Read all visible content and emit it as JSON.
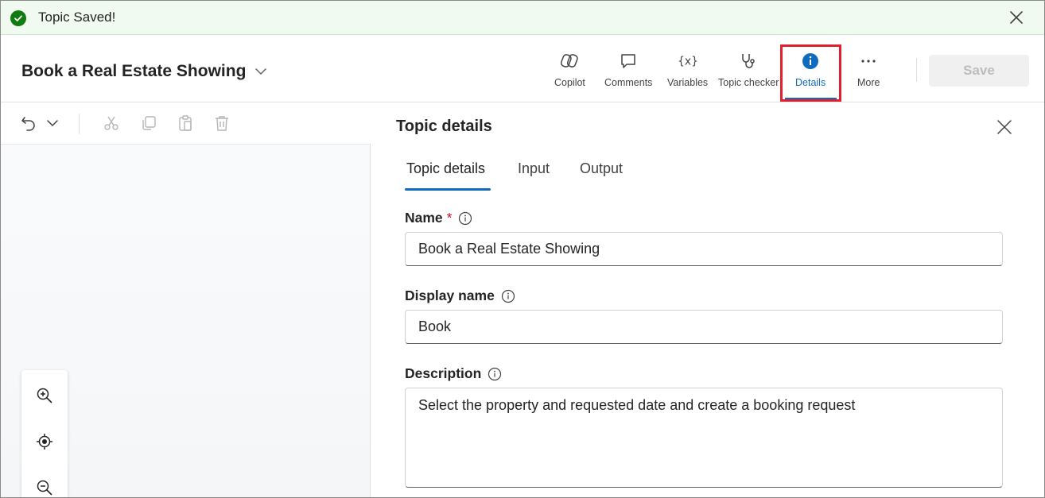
{
  "banner": {
    "message": "Topic Saved!",
    "status_color": "#107c10"
  },
  "header": {
    "title": "Book a Real Estate Showing",
    "tools": [
      {
        "id": "copilot",
        "label": "Copilot",
        "icon": "copilot-icon"
      },
      {
        "id": "comments",
        "label": "Comments",
        "icon": "comment-icon"
      },
      {
        "id": "variables",
        "label": "Variables",
        "icon": "variables-icon"
      },
      {
        "id": "topic_checker",
        "label": "Topic checker",
        "icon": "stethoscope-icon"
      },
      {
        "id": "details",
        "label": "Details",
        "icon": "info-icon",
        "selected": true
      },
      {
        "id": "more",
        "label": "More",
        "icon": "more-icon"
      }
    ],
    "save_label": "Save",
    "accent": "#0f6cbd",
    "highlight_color": "#e0202e"
  },
  "canvas_toolbar": {
    "icons": [
      "undo-icon",
      "chevron-down-icon",
      "cut-icon",
      "copy-icon",
      "paste-icon",
      "delete-icon"
    ]
  },
  "zoom_controls": {
    "icons": [
      "zoom-in-icon",
      "recenter-icon",
      "zoom-out-icon"
    ]
  },
  "panel": {
    "title": "Topic details",
    "tabs": [
      {
        "label": "Topic details",
        "active": true
      },
      {
        "label": "Input",
        "active": false
      },
      {
        "label": "Output",
        "active": false
      }
    ],
    "fields": {
      "name": {
        "label": "Name",
        "required_mark": "*",
        "value": "Book a Real Estate Showing"
      },
      "display_name": {
        "label": "Display name",
        "value": "Book"
      },
      "description": {
        "label": "Description",
        "value": "Select the property and requested date and create a booking request"
      }
    }
  }
}
